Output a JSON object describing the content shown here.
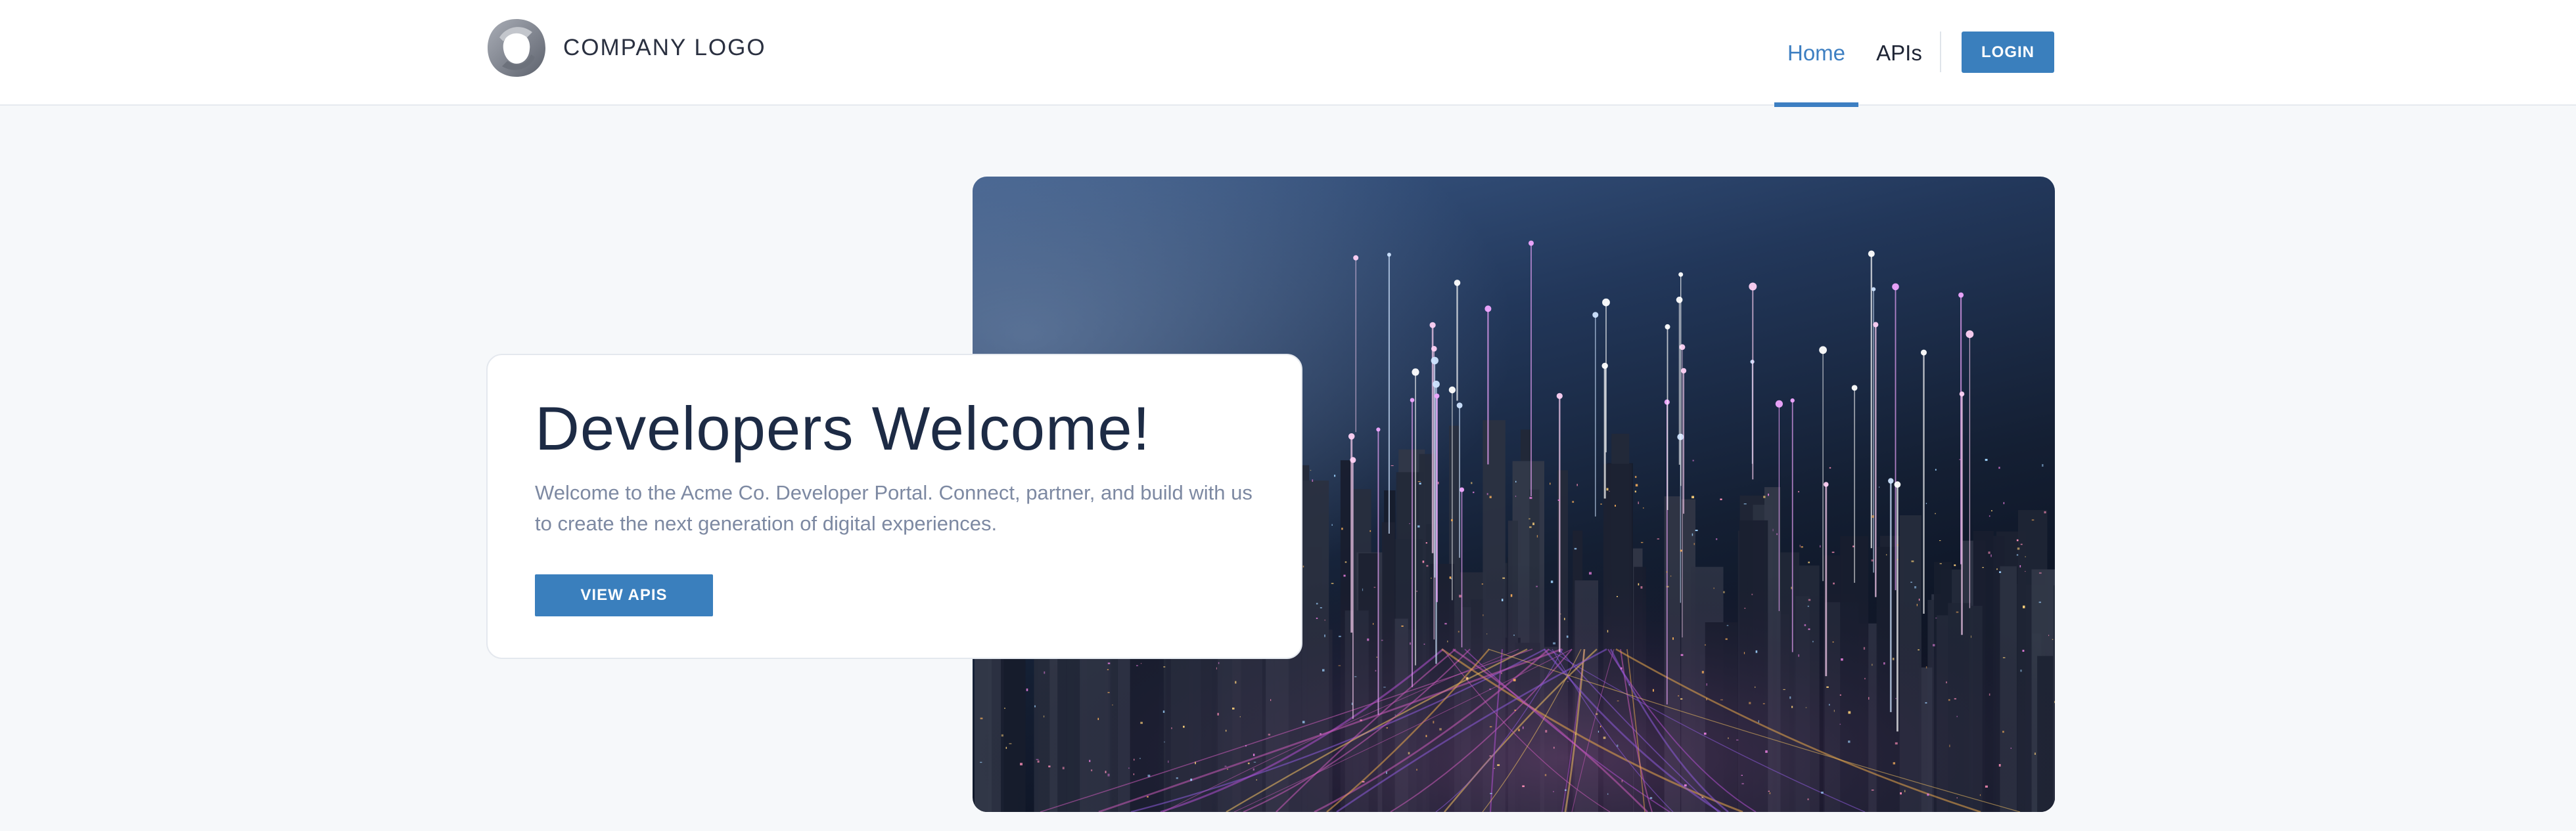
{
  "header": {
    "logo_text": "COMPANY LOGO",
    "nav": {
      "home_label": "Home",
      "apis_label": "APIs",
      "active": "Home"
    },
    "login_label": "LOGIN"
  },
  "hero": {
    "title": "Developers Welcome!",
    "description": "Welcome to the Acme Co. Developer Portal. Connect, partner, and build with us to create the next generation of digital experiences.",
    "cta_label": "VIEW APIS",
    "image_alt": "night city skyline with glowing light beams"
  },
  "colors": {
    "accent": "#3a7fbd",
    "nav_active": "#3d7fc2",
    "title": "#1d2b45",
    "body_text": "#7d89a2",
    "page_bg": "#f6f8fa"
  },
  "icons": {
    "logo": "company-logo-icon"
  }
}
